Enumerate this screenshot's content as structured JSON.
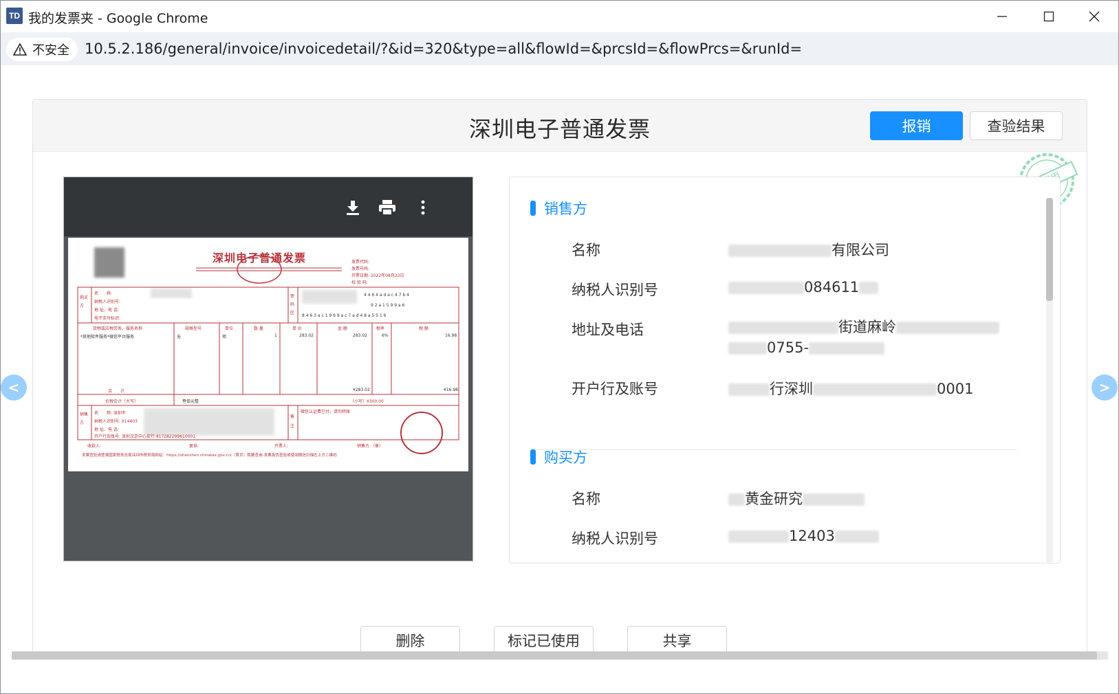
{
  "window": {
    "app_icon": "TD",
    "title": "我的发票夹 - Google Chrome"
  },
  "addressbar": {
    "security_label": "不安全",
    "url": "10.5.2.186/general/invoice/invoicedetail/?&id=320&type=all&flowId=&prcsId=&flowPrcs=&runId="
  },
  "header": {
    "title": "深圳电子普通发票",
    "reimburse_button": "报销",
    "verify_button": "查验结果",
    "stamp_text": "未使用"
  },
  "invoice_image": {
    "title": "深圳电子普通发票",
    "invoice_code_label": "发票代码:",
    "invoice_no_label": "发票号码:",
    "issue_date_label": "开票日期: 2022年08月23日",
    "check_code_label": "校 验 码:",
    "buyer_col": "购买方",
    "fields_buyer": [
      "名　　称:",
      "纳税人识别号:",
      "地 址、电 话:",
      "电子支付标识:"
    ],
    "cipher_area": "密码区",
    "cipher_rows": [
      "4 4 6 4 a d a c 4 7 b 4",
      "9 2 a 1 5 9 9 a 6",
      "8 4 6 3 a c 1 9 6 9 a c 7 a d 4 8 a 5 5 1 6"
    ],
    "item_headers": [
      "货物或应税劳务、服务名称",
      "规格型号",
      "单位",
      "数 量",
      "单 价",
      "金 额",
      "税率",
      "税 额"
    ],
    "item_row": [
      "*其他软件服务*微信平台服务",
      "无",
      "项",
      "1",
      "283.02",
      "283.02",
      "6%",
      "16.98"
    ],
    "total_label": "合　　计",
    "total_amount": "¥283.02",
    "total_tax": "¥16.98",
    "tax_total_label": "价税合计（大写）",
    "tax_total_words": "叁佰元整",
    "tax_total_small": "（小写）¥300.00",
    "seller_col": "销售方",
    "fields_seller": [
      "名　　称: 深圳市",
      "纳税人识别号: 914403",
      "地 址、电 话:",
      "开户行及账号:    深圳汉京中心支行 817282299610001"
    ],
    "remarks_label": "备注",
    "remarks_text": "微信认证费已付，请勿转账",
    "footer_roles": [
      "收款人:",
      "复核:",
      "开票人:",
      "销售方:（章）"
    ],
    "footer_note": "发票查验请登录国家税务总局深圳市税务局网站：https://shenzhen.chinatax.gov.cn/（首页）我要查询-发票真伪查验或使用微信扫描左上方二维码"
  },
  "seller": {
    "section_title": "销售方",
    "name_label": "名称",
    "name_value": "有限公司",
    "tax_id_label": "纳税人识别号",
    "tax_id_value": "084611",
    "address_label": "地址及电话",
    "address_value_1": "街道麻岭",
    "address_value_2": "0755-",
    "bank_label": "开户行及账号",
    "bank_value_1": "行深圳",
    "bank_value_2": "0001"
  },
  "buyer": {
    "section_title": "购买方",
    "name_label": "名称",
    "name_value": "黄金研究",
    "tax_id_label": "纳税人识别号",
    "tax_id_value": "12403"
  },
  "footer": {
    "delete_button": "删除",
    "mark_used_button": "标记已使用",
    "share_button": "共享"
  },
  "nav": {
    "prev": "<",
    "next": ">"
  },
  "colors": {
    "primary": "#1890ff",
    "stamp_green": "#3dbf7a",
    "invoice_red": "#b8323a"
  }
}
